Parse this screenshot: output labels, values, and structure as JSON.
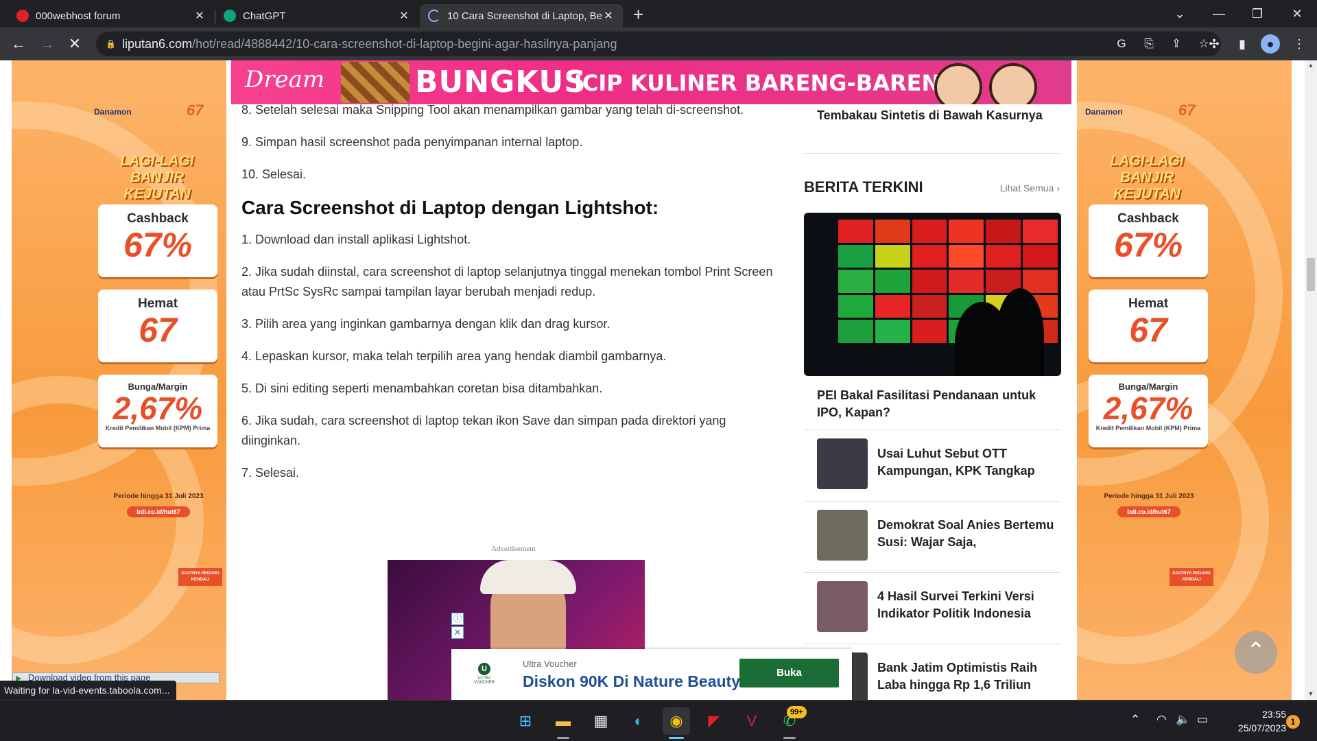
{
  "browser": {
    "tabs": [
      {
        "title": "000webhost forum",
        "favicon_color": "#e0202a"
      },
      {
        "title": "ChatGPT",
        "favicon_color": "#10a37f"
      },
      {
        "title": "10 Cara Screenshot di Laptop, Be",
        "favicon_color": "#8ab4f8",
        "loading": true
      }
    ],
    "url_host": "liputan6.com",
    "url_path": "/hot/read/4888442/10-cara-screenshot-di-laptop-begini-agar-hasilnya-panjang",
    "new_tab_glyph": "+",
    "status_text": "Waiting for la-vid-events.taboola.com..."
  },
  "side_ad": {
    "brand": "Danamon",
    "anniversary": "67",
    "headline_1": "LAGI-LAGI",
    "headline_2": "BANJIR KEJUTAN",
    "cards": [
      {
        "label": "Cashback",
        "value": "67%"
      },
      {
        "label": "Hemat",
        "value": "67"
      },
      {
        "label": "Bunga/Margin",
        "value": "2,67%"
      }
    ],
    "card_note": "Kredit Pemilikan Mobil (KPM) Prima",
    "period": "Periode hingga 31 Juli 2023",
    "link": "bdi.co.id/hut67",
    "tagline": "SAATNYA PEGANG KENDALI"
  },
  "banner": {
    "brand": "Dream",
    "headline": "BUNGKUS",
    "subline": "ICIP KULINER BARENG-BARENG"
  },
  "article": {
    "paragraphs_top": [
      "8. Setelah selesai maka Snipping Tool akan menampilkan gambar yang telah di-screenshot.",
      "9. Simpan hasil screenshot pada penyimpanan internal laptop.",
      "10. Selesai."
    ],
    "heading": "Cara Screenshot di Laptop dengan Lightshot:",
    "paragraphs_bottom": [
      "1. Download dan install aplikasi Lightshot.",
      "2. Jika sudah diinstal, cara screenshot di laptop selanjutnya tinggal menekan tombol Print Screen atau PrtSc SysRc sampai tampilan layar berubah menjadi redup.",
      "3. Pilih area yang inginkan gambarnya dengan klik dan drag kursor.",
      "4. Lepaskan kursor, maka telah terpilih area yang hendak diambil gambarnya.",
      "5. Di sini editing seperti menambahkan coretan bisa ditambahkan.",
      "6. Jika sudah, cara screenshot di laptop tekan ikon Save dan simpan pada direktori yang diinginkan.",
      "7. Selesai."
    ],
    "ad_label": "Advertisement"
  },
  "sidebar": {
    "top_title": "Tembakau Sintetis di Bawah Kasurnya",
    "section_title": "BERITA TERKINI",
    "see_all": "Lihat Semua",
    "hero_title": "PEI Bakal Fasilitasi Pendanaan untuk IPO, Kapan?",
    "items": [
      {
        "title": "Usai Luhut Sebut OTT Kampungan, KPK Tangkap",
        "thumb_color": "#3b3b45"
      },
      {
        "title": "Demokrat Soal Anies Bertemu Susi: Wajar Saja,",
        "thumb_color": "#6f6a5e"
      },
      {
        "title": "4 Hasil Survei Terkini Versi Indikator Politik Indonesia",
        "thumb_color": "#7a5c66"
      },
      {
        "title": "Bank Jatim Optimistis Raih Laba hingga Rp 1,6 Triliun",
        "thumb_color": "#3a3a3a"
      }
    ]
  },
  "sticky_ad": {
    "sponsor": "Ultra Voucher",
    "logo_text": "ULTRA VOUCHER",
    "headline": "Diskon 90K Di Nature Beauty",
    "cta": "Buka"
  },
  "video_helper": "Download video from this page",
  "taskbar": {
    "time": "23:55",
    "date": "25/07/2023",
    "whatsapp_badge": "99+",
    "notification_count": "1"
  }
}
